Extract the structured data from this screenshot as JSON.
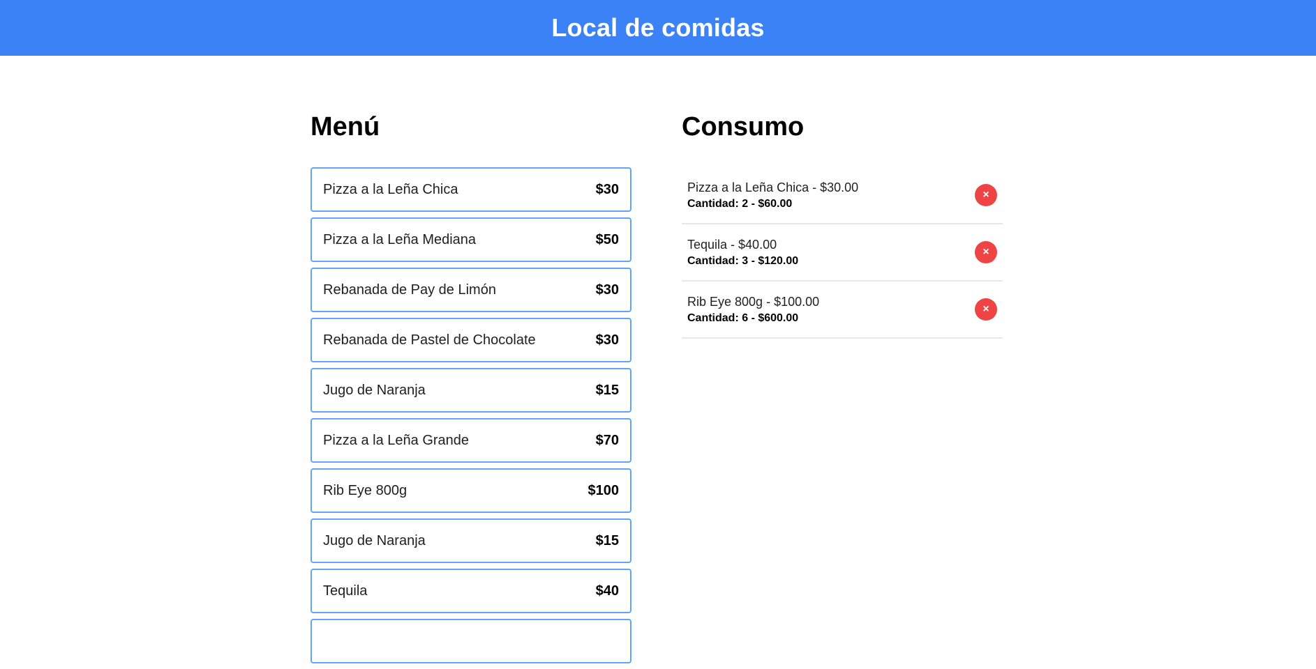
{
  "header": {
    "title": "Local de comidas"
  },
  "menu": {
    "title": "Menú",
    "items": [
      {
        "name": "Pizza a la Leña Chica",
        "price": "$30"
      },
      {
        "name": "Pizza a la Leña Mediana",
        "price": "$50"
      },
      {
        "name": "Rebanada de Pay de Limón",
        "price": "$30"
      },
      {
        "name": "Rebanada de Pastel de Chocolate",
        "price": "$30"
      },
      {
        "name": "Jugo de Naranja",
        "price": "$15"
      },
      {
        "name": "Pizza a la Leña Grande",
        "price": "$70"
      },
      {
        "name": "Rib Eye 800g",
        "price": "$100"
      },
      {
        "name": "Jugo de Naranja",
        "price": "$15"
      },
      {
        "name": "Tequila",
        "price": "$40"
      },
      {
        "name": "",
        "price": ""
      }
    ]
  },
  "consumo": {
    "title": "Consumo",
    "items": [
      {
        "line1": "Pizza a la Leña Chica - $30.00",
        "line2": "Cantidad: 2 - $60.00",
        "remove_label": "×"
      },
      {
        "line1": "Tequila - $40.00",
        "line2": "Cantidad: 3 - $120.00",
        "remove_label": "×"
      },
      {
        "line1": "Rib Eye 800g - $100.00",
        "line2": "Cantidad: 6 - $600.00",
        "remove_label": "×"
      }
    ]
  },
  "colors": {
    "header_bg": "#3b82f6",
    "item_border": "#60a5fa",
    "remove_bg": "#ef4444",
    "divider": "#e5e7eb"
  }
}
